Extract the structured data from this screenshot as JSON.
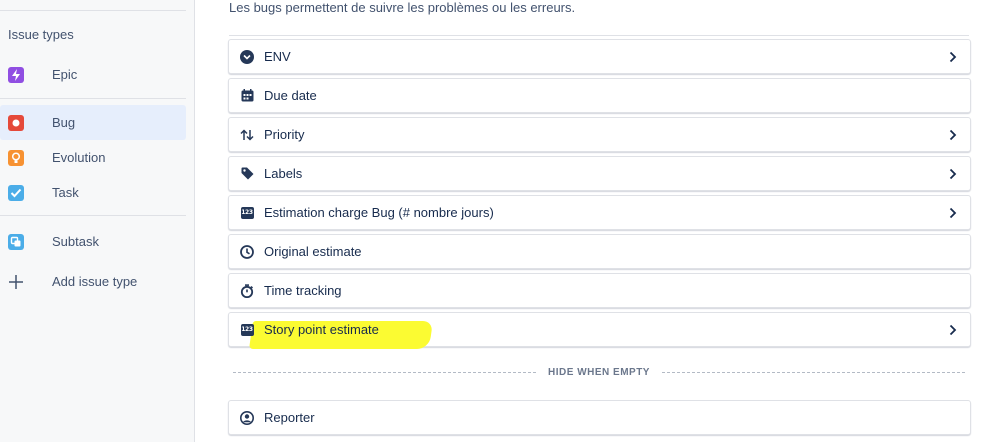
{
  "sidebar": {
    "heading": "Issue types",
    "items": [
      {
        "label": "Epic",
        "icon": "lightning-icon",
        "color": "#904ee2",
        "selected": false
      },
      {
        "label": "Bug",
        "icon": "bug-icon",
        "color": "#e5493a",
        "selected": true
      },
      {
        "label": "Evolution",
        "icon": "lightbulb-icon",
        "color": "#f79232",
        "selected": false
      },
      {
        "label": "Task",
        "icon": "checkmark-icon",
        "color": "#4bade8",
        "selected": false
      },
      {
        "label": "Subtask",
        "icon": "subtask-icon",
        "color": "#4bade8",
        "selected": false
      },
      {
        "label": "Add issue type",
        "icon": "plus-icon",
        "color": "#42526e",
        "selected": false
      }
    ]
  },
  "main": {
    "description": "Les bugs permettent de suivre les problèmes ou les erreurs.",
    "fields": [
      {
        "label": "ENV",
        "icon": "chevron-circle-down-icon",
        "has_chevron": true
      },
      {
        "label": "Due date",
        "icon": "calendar-icon",
        "has_chevron": false
      },
      {
        "label": "Priority",
        "icon": "priority-arrows-icon",
        "has_chevron": true
      },
      {
        "label": "Labels",
        "icon": "tag-icon",
        "has_chevron": true
      },
      {
        "label": "Estimation charge Bug (# nombre jours)",
        "icon": "number-123-icon",
        "has_chevron": true,
        "icon_text": "123"
      },
      {
        "label": "Original estimate",
        "icon": "clock-icon",
        "has_chevron": false
      },
      {
        "label": "Time tracking",
        "icon": "stopwatch-icon",
        "has_chevron": false
      },
      {
        "label": "Story point estimate",
        "icon": "number-123-icon",
        "has_chevron": true,
        "icon_text": "123",
        "highlighted": true
      }
    ],
    "hide_when_empty_label": "HIDE WHEN EMPTY",
    "hidden_fields": [
      {
        "label": "Reporter",
        "icon": "person-icon",
        "has_chevron": false
      }
    ]
  },
  "colors": {
    "highlight": "#fbfb32",
    "selected_bg": "#e6eefc",
    "border": "#dfe1e6"
  }
}
